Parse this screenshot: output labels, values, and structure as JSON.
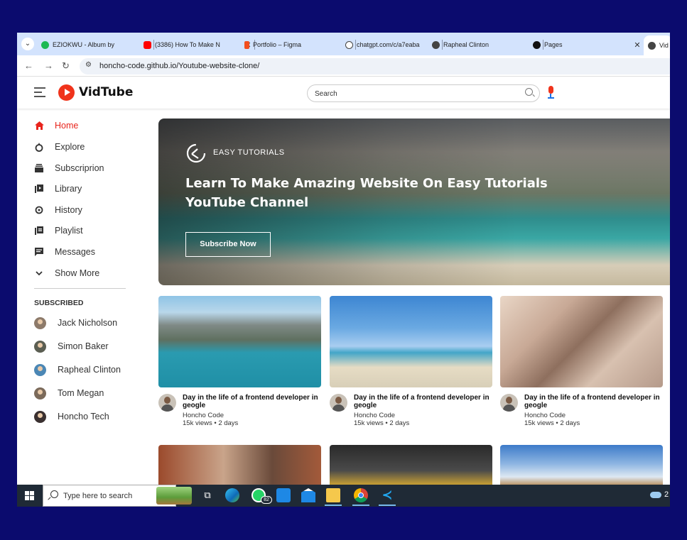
{
  "browser": {
    "tabs": [
      {
        "title": "EZIOKWU - Album by",
        "fav": "#1db954",
        "left": 0
      },
      {
        "title": "(3386) How To Make N",
        "fav": "#ff0000"
      },
      {
        "title": "Portfolio – Figma",
        "fav": "#f24e1e"
      },
      {
        "title": "chatgpt.com/c/a7eaba",
        "fav": "#444444"
      },
      {
        "title": "Rapheal Clinton",
        "fav": "#444444"
      },
      {
        "title": "Pages",
        "fav": "#111111"
      },
      {
        "title": "Vid",
        "fav": "#444444"
      }
    ],
    "url": "honcho-code.github.io/Youtube-website-clone/"
  },
  "site": {
    "logo_text": "VidTube",
    "search_placeholder": "Search",
    "nav": [
      {
        "label": "Home",
        "icon": "home-icon",
        "active": true
      },
      {
        "label": "Explore",
        "icon": "explore-icon"
      },
      {
        "label": "Subscriprion",
        "icon": "subscription-icon"
      },
      {
        "label": "Library",
        "icon": "library-icon"
      },
      {
        "label": "History",
        "icon": "history-icon"
      },
      {
        "label": "Playlist",
        "icon": "playlist-icon"
      },
      {
        "label": "Messages",
        "icon": "messages-icon"
      },
      {
        "label": "Show More",
        "icon": "chevron-down-icon"
      }
    ],
    "subscribed_heading": "SUBSCRIBED",
    "subscriptions": [
      {
        "name": "Jack Nicholson",
        "color": "#8d7a6a"
      },
      {
        "name": "Simon Baker",
        "color": "#5b5e52"
      },
      {
        "name": "Rapheal Clinton",
        "color": "#4b87b5"
      },
      {
        "name": "Tom Megan",
        "color": "#7b6a5a"
      },
      {
        "name": "Honcho Tech",
        "color": "#3a3030"
      }
    ],
    "banner": {
      "brand": "EASY TUTORIALS",
      "title": "Learn To Make Amazing Website On Easy Tutorials YouTube Channel",
      "button": "Subscribe Now"
    },
    "videos": [
      {
        "title": "Day in the life of a frontend developer in geogle",
        "channel": "Honcho Code",
        "meta": "15k views • 2 days"
      },
      {
        "title": "Day in the life of a frontend developer in geogle",
        "channel": "Honcho Code",
        "meta": "15k views • 2 days"
      },
      {
        "title": "Day in the life of a frontend developer in geogle",
        "channel": "Honcho Code",
        "meta": "15k views • 2 days"
      }
    ]
  },
  "taskbar": {
    "search_placeholder": "Type here to search",
    "whatsapp_badge": "82",
    "weather_text": "2"
  },
  "colors": {
    "brand_red": "#f0331b",
    "active_red": "#e8241c",
    "screen_bg": "#0b0b6e",
    "tabbar": "#d3e3fd",
    "taskbar": "#1f2a36"
  }
}
